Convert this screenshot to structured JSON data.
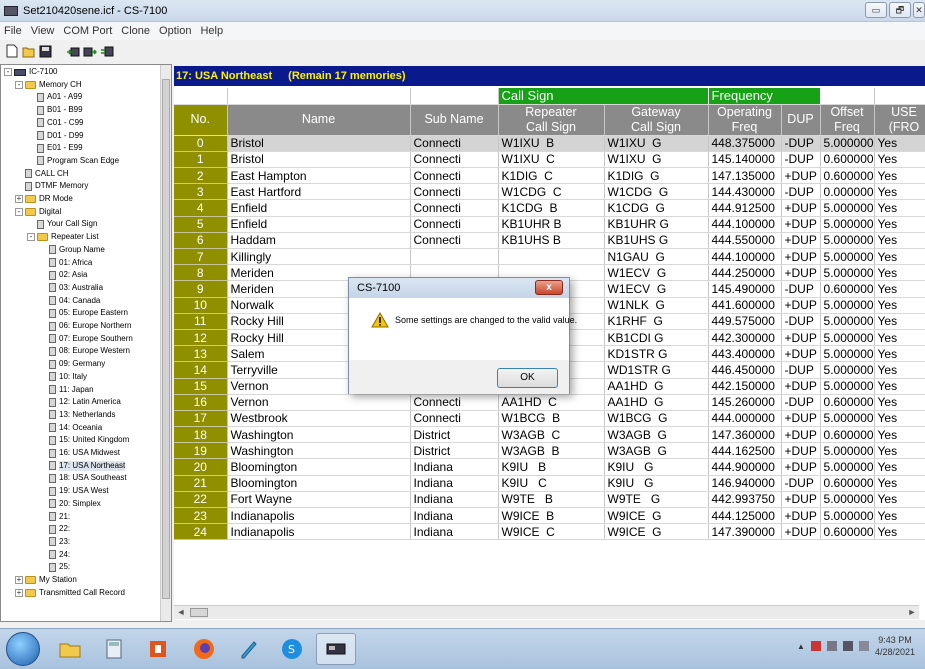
{
  "window": {
    "title": "Set210420sene.icf - CS-7100",
    "minimize_label": "▭",
    "maximize_label": "🗗",
    "close_label": "✕"
  },
  "menu": [
    "File",
    "View",
    "COM Port",
    "Clone",
    "Option",
    "Help"
  ],
  "toolbar": [
    "new-icon",
    "open-icon",
    "save-icon",
    "read-from-radio-icon",
    "write-to-radio-icon",
    "clone-icon"
  ],
  "tree": {
    "items": [
      {
        "label": "IC-7100",
        "level": 0,
        "kind": "radio",
        "expander": "-"
      },
      {
        "label": "Memory CH",
        "level": 1,
        "kind": "folder",
        "expander": "-"
      },
      {
        "label": "A01 - A99",
        "level": 2,
        "kind": "doc"
      },
      {
        "label": "B01 - B99",
        "level": 2,
        "kind": "doc"
      },
      {
        "label": "C01 - C99",
        "level": 2,
        "kind": "doc"
      },
      {
        "label": "D01 - D99",
        "level": 2,
        "kind": "doc"
      },
      {
        "label": "E01 - E99",
        "level": 2,
        "kind": "doc"
      },
      {
        "label": "Program Scan Edge",
        "level": 2,
        "kind": "doc"
      },
      {
        "label": "CALL CH",
        "level": 1,
        "kind": "doc"
      },
      {
        "label": "DTMF Memory",
        "level": 1,
        "kind": "doc"
      },
      {
        "label": "DR Mode",
        "level": 1,
        "kind": "folder",
        "expander": "+"
      },
      {
        "label": "Digital",
        "level": 1,
        "kind": "folder",
        "expander": "-"
      },
      {
        "label": "Your Call Sign",
        "level": 2,
        "kind": "doc"
      },
      {
        "label": "Repeater List",
        "level": 2,
        "kind": "folder",
        "expander": "-"
      },
      {
        "label": "Group Name",
        "level": 3,
        "kind": "doc"
      },
      {
        "label": "01: Africa",
        "level": 3,
        "kind": "doc"
      },
      {
        "label": "02: Asia",
        "level": 3,
        "kind": "doc"
      },
      {
        "label": "03: Australia",
        "level": 3,
        "kind": "doc"
      },
      {
        "label": "04: Canada",
        "level": 3,
        "kind": "doc"
      },
      {
        "label": "05: Europe Eastern",
        "level": 3,
        "kind": "doc"
      },
      {
        "label": "06: Europe Northern",
        "level": 3,
        "kind": "doc"
      },
      {
        "label": "07: Europe Southern",
        "level": 3,
        "kind": "doc"
      },
      {
        "label": "08: Europe Western",
        "level": 3,
        "kind": "doc"
      },
      {
        "label": "09: Germany",
        "level": 3,
        "kind": "doc"
      },
      {
        "label": "10: Italy",
        "level": 3,
        "kind": "doc"
      },
      {
        "label": "11: Japan",
        "level": 3,
        "kind": "doc"
      },
      {
        "label": "12: Latin America",
        "level": 3,
        "kind": "doc"
      },
      {
        "label": "13: Netherlands",
        "level": 3,
        "kind": "doc"
      },
      {
        "label": "14: Oceania",
        "level": 3,
        "kind": "doc"
      },
      {
        "label": "15: United Kingdom",
        "level": 3,
        "kind": "doc"
      },
      {
        "label": "16: USA Midwest",
        "level": 3,
        "kind": "doc"
      },
      {
        "label": "17: USA Northeast",
        "level": 3,
        "kind": "doc",
        "selected": true
      },
      {
        "label": "18: USA Southeast",
        "level": 3,
        "kind": "doc"
      },
      {
        "label": "19: USA West",
        "level": 3,
        "kind": "doc"
      },
      {
        "label": "20: Simplex",
        "level": 3,
        "kind": "doc"
      },
      {
        "label": "21:",
        "level": 3,
        "kind": "doc"
      },
      {
        "label": "22:",
        "level": 3,
        "kind": "doc"
      },
      {
        "label": "23:",
        "level": 3,
        "kind": "doc"
      },
      {
        "label": "24:",
        "level": 3,
        "kind": "doc"
      },
      {
        "label": "25:",
        "level": 3,
        "kind": "doc"
      },
      {
        "label": "My Station",
        "level": 1,
        "kind": "folder",
        "expander": "+"
      },
      {
        "label": "Transmitted Call Record",
        "level": 1,
        "kind": "folder",
        "expander": "+"
      }
    ]
  },
  "grid": {
    "group_title": "17: USA Northeast",
    "remain": "(Remain 17 memories)",
    "group_headers": {
      "call_sign": "Call Sign",
      "frequency": "Frequency"
    },
    "columns": [
      "No.",
      "Name",
      "Sub Name",
      "Repeater\nCall Sign",
      "Gateway\nCall Sign",
      "Operating\nFreq",
      "DUP",
      "Offset\nFreq",
      "USE\n(FRO"
    ],
    "rows": [
      [
        "0",
        "Bristol",
        "Connecti",
        "W1IXU  B",
        "W1IXU  G",
        "448.375000",
        "-DUP",
        "5.000000",
        "Yes"
      ],
      [
        "1",
        "Bristol",
        "Connecti",
        "W1IXU  C",
        "W1IXU  G",
        "145.140000",
        "-DUP",
        "0.600000",
        "Yes"
      ],
      [
        "2",
        "East Hampton",
        "Connecti",
        "K1DIG  C",
        "K1DIG  G",
        "147.135000",
        "+DUP",
        "0.600000",
        "Yes"
      ],
      [
        "3",
        "East Hartford",
        "Connecti",
        "W1CDG  C",
        "W1CDG  G",
        "144.430000",
        "-DUP",
        "0.000000",
        "Yes"
      ],
      [
        "4",
        "Enfield",
        "Connecti",
        "K1CDG  B",
        "K1CDG  G",
        "444.912500",
        "+DUP",
        "5.000000",
        "Yes"
      ],
      [
        "5",
        "Enfield",
        "Connecti",
        "KB1UHR B",
        "KB1UHR G",
        "444.100000",
        "+DUP",
        "5.000000",
        "Yes"
      ],
      [
        "6",
        "Haddam",
        "Connecti",
        "KB1UHS B",
        "KB1UHS G",
        "444.550000",
        "+DUP",
        "5.000000",
        "Yes"
      ],
      [
        "7",
        "Killingly",
        "",
        "",
        "N1GAU  G",
        "444.100000",
        "+DUP",
        "5.000000",
        "Yes"
      ],
      [
        "8",
        "Meriden",
        "",
        "",
        "W1ECV  G",
        "444.250000",
        "+DUP",
        "5.000000",
        "Yes"
      ],
      [
        "9",
        "Meriden",
        "",
        "",
        "W1ECV  G",
        "145.490000",
        "-DUP",
        "0.600000",
        "Yes"
      ],
      [
        "10",
        "Norwalk",
        "",
        "",
        "W1NLK  G",
        "441.600000",
        "+DUP",
        "5.000000",
        "Yes"
      ],
      [
        "11",
        "Rocky Hill",
        "",
        "",
        "K1RHF  G",
        "449.575000",
        "-DUP",
        "5.000000",
        "Yes"
      ],
      [
        "12",
        "Rocky Hill",
        "",
        "",
        "KB1CDI G",
        "442.300000",
        "+DUP",
        "5.000000",
        "Yes"
      ],
      [
        "13",
        "Salem",
        "",
        "",
        "KD1STR G",
        "443.400000",
        "+DUP",
        "5.000000",
        "Yes"
      ],
      [
        "14",
        "Terryville",
        "",
        "",
        "WD1STR G",
        "446.450000",
        "-DUP",
        "5.000000",
        "Yes"
      ],
      [
        "15",
        "Vernon",
        "Connecti",
        "AA1HD  B",
        "AA1HD  G",
        "442.150000",
        "+DUP",
        "5.000000",
        "Yes"
      ],
      [
        "16",
        "Vernon",
        "Connecti",
        "AA1HD  C",
        "AA1HD  G",
        "145.260000",
        "-DUP",
        "0.600000",
        "Yes"
      ],
      [
        "17",
        "Westbrook",
        "Connecti",
        "W1BCG  B",
        "W1BCG  G",
        "444.000000",
        "+DUP",
        "5.000000",
        "Yes"
      ],
      [
        "18",
        "Washington",
        "District",
        "W3AGB  C",
        "W3AGB  G",
        "147.360000",
        "+DUP",
        "0.600000",
        "Yes"
      ],
      [
        "19",
        "Washington",
        "District",
        "W3AGB  B",
        "W3AGB  G",
        "444.162500",
        "+DUP",
        "5.000000",
        "Yes"
      ],
      [
        "20",
        "Bloomington",
        "Indiana",
        "K9IU   B",
        "K9IU   G",
        "444.900000",
        "+DUP",
        "5.000000",
        "Yes"
      ],
      [
        "21",
        "Bloomington",
        "Indiana",
        "K9IU   C",
        "K9IU   G",
        "146.940000",
        "-DUP",
        "0.600000",
        "Yes"
      ],
      [
        "22",
        "Fort Wayne",
        "Indiana",
        "W9TE   B",
        "W9TE   G",
        "442.993750",
        "+DUP",
        "5.000000",
        "Yes"
      ],
      [
        "23",
        "Indianapolis",
        "Indiana",
        "W9ICE  B",
        "W9ICE  G",
        "444.125000",
        "+DUP",
        "5.000000",
        "Yes"
      ],
      [
        "24",
        "Indianapolis",
        "Indiana",
        "W9ICE  C",
        "W9ICE  G",
        "147.390000",
        "+DUP",
        "0.600000",
        "Yes"
      ]
    ]
  },
  "dialog": {
    "title": "CS-7100",
    "message": "Some settings are changed to the valid value.",
    "ok_label": "OK",
    "close_label": "x"
  },
  "taskbar": {
    "apps": [
      "start-icon",
      "file-explorer-icon",
      "calculator-icon",
      "office-icon",
      "firefox-icon",
      "notepad-icon",
      "skype-icon",
      "cs-7100-icon"
    ],
    "time": "9:43 PM",
    "date": "4/28/2021"
  },
  "colors": {
    "header_band_bg": "#0a1a8c",
    "header_band_text": "#fff200",
    "group_header_green": "#17a117",
    "col_header_gray": "#8a8a8a",
    "number_col_olive": "#8f8f00",
    "selected_row": "#d4d4d4"
  }
}
